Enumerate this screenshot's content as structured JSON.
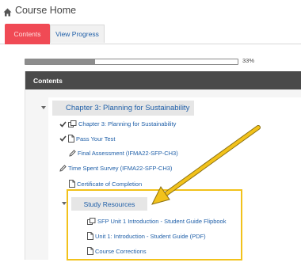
{
  "header": {
    "title": "Course Home",
    "icon": "home-icon"
  },
  "tabs": [
    {
      "label": "Contents",
      "active": true
    },
    {
      "label": "View Progress",
      "active": false
    }
  ],
  "progress": {
    "percent": 33,
    "text": "33%"
  },
  "panel": {
    "title": "Contents"
  },
  "chapter": {
    "label": "Chapter 3: Planning for Sustainability"
  },
  "items": [
    {
      "label": "Chapter 3: Planning for Sustainability",
      "icon": "flipbook-icon",
      "completed": true
    },
    {
      "label": "Pass Your Test",
      "icon": "document-icon",
      "completed": true
    },
    {
      "label": "Final Assessment (IFMA22-SFP-CH3)",
      "icon": "pencil-icon",
      "completed": false
    },
    {
      "label": "Time Spent Survey (IFMA22-SFP-CH3)",
      "icon": "pencil-icon",
      "completed": false
    },
    {
      "label": "Certificate of Completion",
      "icon": "document-icon",
      "completed": false
    }
  ],
  "study_resources": {
    "label": "Study Resources",
    "items": [
      {
        "label": "SFP Unit 1 Introduction - Student Guide Flipbook",
        "icon": "flipbook-icon"
      },
      {
        "label": "Unit 1: Introduction - Student Guide (PDF)",
        "icon": "document-icon"
      },
      {
        "label": "Course Corrections",
        "icon": "document-icon"
      }
    ]
  },
  "colors": {
    "accent_tab": "#f04a55",
    "link": "#1f5fa8",
    "highlight": "#f2c21b",
    "header_bar": "#4a4a4a"
  }
}
